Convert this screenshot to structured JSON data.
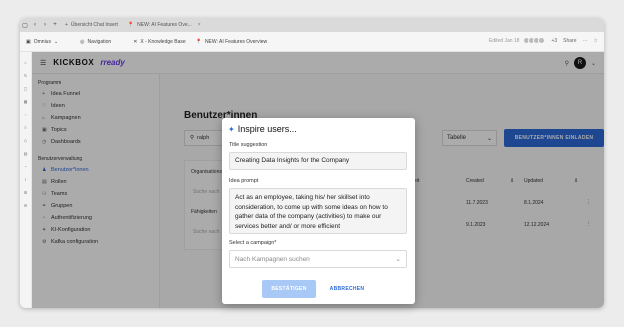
{
  "browser": {
    "tabs": [
      {
        "label": "Übersicht Chat Insert"
      },
      {
        "label": "NEW: AI Features Ove..."
      }
    ],
    "workspace": "Omnius",
    "bookmarks": [
      {
        "label": "Navigation"
      },
      {
        "label": "X - Knowledge Base"
      },
      {
        "label": "NEW: AI Features Overview"
      }
    ],
    "edited": "Edited Jan 18",
    "collab_count": "+3",
    "share_label": "Share"
  },
  "app": {
    "logo_primary": "KICKBOX",
    "logo_secondary": "rready",
    "user_initial": "R"
  },
  "sidebar": {
    "section_program": "Programm",
    "program_items": [
      {
        "label": "Idea Funnel",
        "icon": "+"
      },
      {
        "label": "Ideen",
        "icon": "♡"
      },
      {
        "label": "Kampagnen",
        "icon": "⌂"
      },
      {
        "label": "Topics",
        "icon": "▣"
      },
      {
        "label": "Dashboards",
        "icon": "◷"
      }
    ],
    "section_admin": "Benutzerverwaltung",
    "admin_items": [
      {
        "label": "Benutzer*innen",
        "icon": "♟",
        "active": true
      },
      {
        "label": "Rollen",
        "icon": "▤"
      },
      {
        "label": "Teams",
        "icon": "⚇"
      },
      {
        "label": "Gruppen",
        "icon": "⚭"
      },
      {
        "label": "Authentifizierung",
        "icon": "◔"
      },
      {
        "label": "KI-Konfiguration",
        "icon": "✦"
      },
      {
        "label": "Kafka configuration",
        "icon": "⚙"
      }
    ]
  },
  "main": {
    "title": "Benutzer*innen",
    "search_value": "ralph",
    "view_select": "Tabelle",
    "invite_button": "BENUTZER*INNEN EINLADEN",
    "filter_org": "Organisationseinheit",
    "filter_skills": "Fähigkeiten",
    "filter_placeholder": "Suche nach",
    "col_unit": "Einheit",
    "col_created": "Created",
    "col_updated": "Updated",
    "rows": [
      {
        "created": "11.7.2023",
        "updated": "8.1.2024"
      },
      {
        "created": "9.1.2023",
        "updated": "12.12.2024"
      }
    ]
  },
  "modal": {
    "title": "Inspire users...",
    "title_label": "Title suggestion",
    "title_value": "Creating Data Insights for the Company",
    "prompt_label": "Idea prompt",
    "prompt_value": "Act as an employee, taking his/ her skillset into consideration, to come up with some ideas on how to gather data of the company (activities) to make our services better and/ or more efficient",
    "campaign_label": "Select a campaign*",
    "campaign_placeholder": "Nach Kampagnen suchen",
    "confirm_button": "BESTÄTIGEN",
    "cancel_button": "ABBRECHEN"
  },
  "colors": {
    "accent": "#2d6bd9",
    "brand_purple": "#6b3be8",
    "confirm_disabled": "#a8c8f5"
  }
}
